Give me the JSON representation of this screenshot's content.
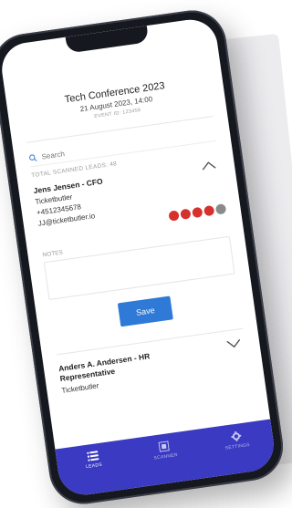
{
  "event": {
    "title": "Tech Conference 2023",
    "date": "21 August 2023, 14:00",
    "event_id": "EVENT ID: 123456"
  },
  "search": {
    "placeholder": "Search"
  },
  "total_scanned": "TOTAL SCANNED LEADS: 48",
  "leads": [
    {
      "name": "Jens Jensen - CFO",
      "company": "Ticketbutler",
      "phone": "+4512345678",
      "email": "JJ@ticketbutler.io",
      "rating": 4,
      "rating_max": 5,
      "expanded": true
    },
    {
      "name": "Anders A. Andersen - HR Representative",
      "company": "Ticketbutler",
      "expanded": false
    }
  ],
  "notes": {
    "label": "NOTES",
    "value": ""
  },
  "save_label": "Save",
  "tabs": [
    {
      "label": "LEADS",
      "icon": "list-icon",
      "active": true
    },
    {
      "label": "SCANNER",
      "icon": "qr-scanner-icon",
      "active": false
    },
    {
      "label": "SETTINGS",
      "icon": "gear-icon",
      "active": false
    }
  ],
  "colors": {
    "primary_button": "#2f7ad7",
    "tab_bar": "#3a3ac2",
    "flame_active": "#d6322d",
    "flame_inactive": "#8a8a8a"
  }
}
